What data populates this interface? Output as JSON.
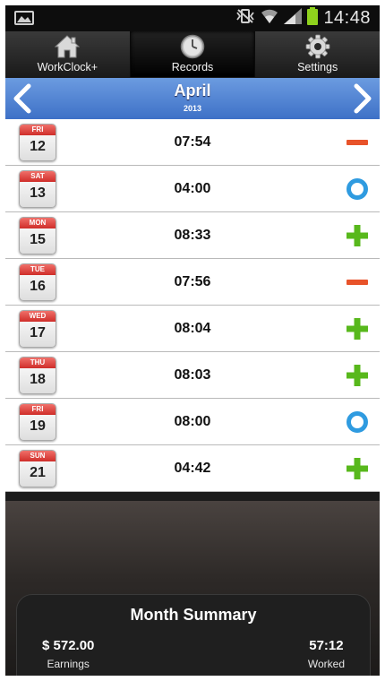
{
  "status_bar": {
    "time": "14:48",
    "icons": [
      "picture-icon",
      "vibrate-mute-icon",
      "wifi-icon",
      "signal-icon",
      "battery-icon"
    ],
    "battery_color": "#8fd21d"
  },
  "tabs": [
    {
      "label": "WorkClock+",
      "icon": "home-icon",
      "active": false
    },
    {
      "label": "Records",
      "icon": "clock-icon",
      "active": true
    },
    {
      "label": "Settings",
      "icon": "gear-icon",
      "active": false
    }
  ],
  "month_header": {
    "month": "April",
    "year": "2013",
    "prev_icon": "chevron-left-icon",
    "next_icon": "chevron-right-icon",
    "bg_color": "#4f82d1"
  },
  "records": [
    {
      "dow": "FRI",
      "day": "12",
      "time": "07:54",
      "status": "minus"
    },
    {
      "dow": "SAT",
      "day": "13",
      "time": "04:00",
      "status": "circle"
    },
    {
      "dow": "MON",
      "day": "15",
      "time": "08:33",
      "status": "plus"
    },
    {
      "dow": "TUE",
      "day": "16",
      "time": "07:56",
      "status": "minus"
    },
    {
      "dow": "WED",
      "day": "17",
      "time": "08:04",
      "status": "plus"
    },
    {
      "dow": "THU",
      "day": "18",
      "time": "08:03",
      "status": "plus"
    },
    {
      "dow": "FRI",
      "day": "19",
      "time": "08:00",
      "status": "circle"
    },
    {
      "dow": "SUN",
      "day": "21",
      "time": "04:42",
      "status": "plus"
    }
  ],
  "status_colors": {
    "minus": "#e8532a",
    "plus": "#58b81c",
    "circle": "#2f9be0"
  },
  "summary": {
    "title": "Month Summary",
    "earnings_value": "$ 572.00",
    "earnings_label": "Earnings",
    "worked_value": "57:12",
    "worked_label": "Worked"
  }
}
